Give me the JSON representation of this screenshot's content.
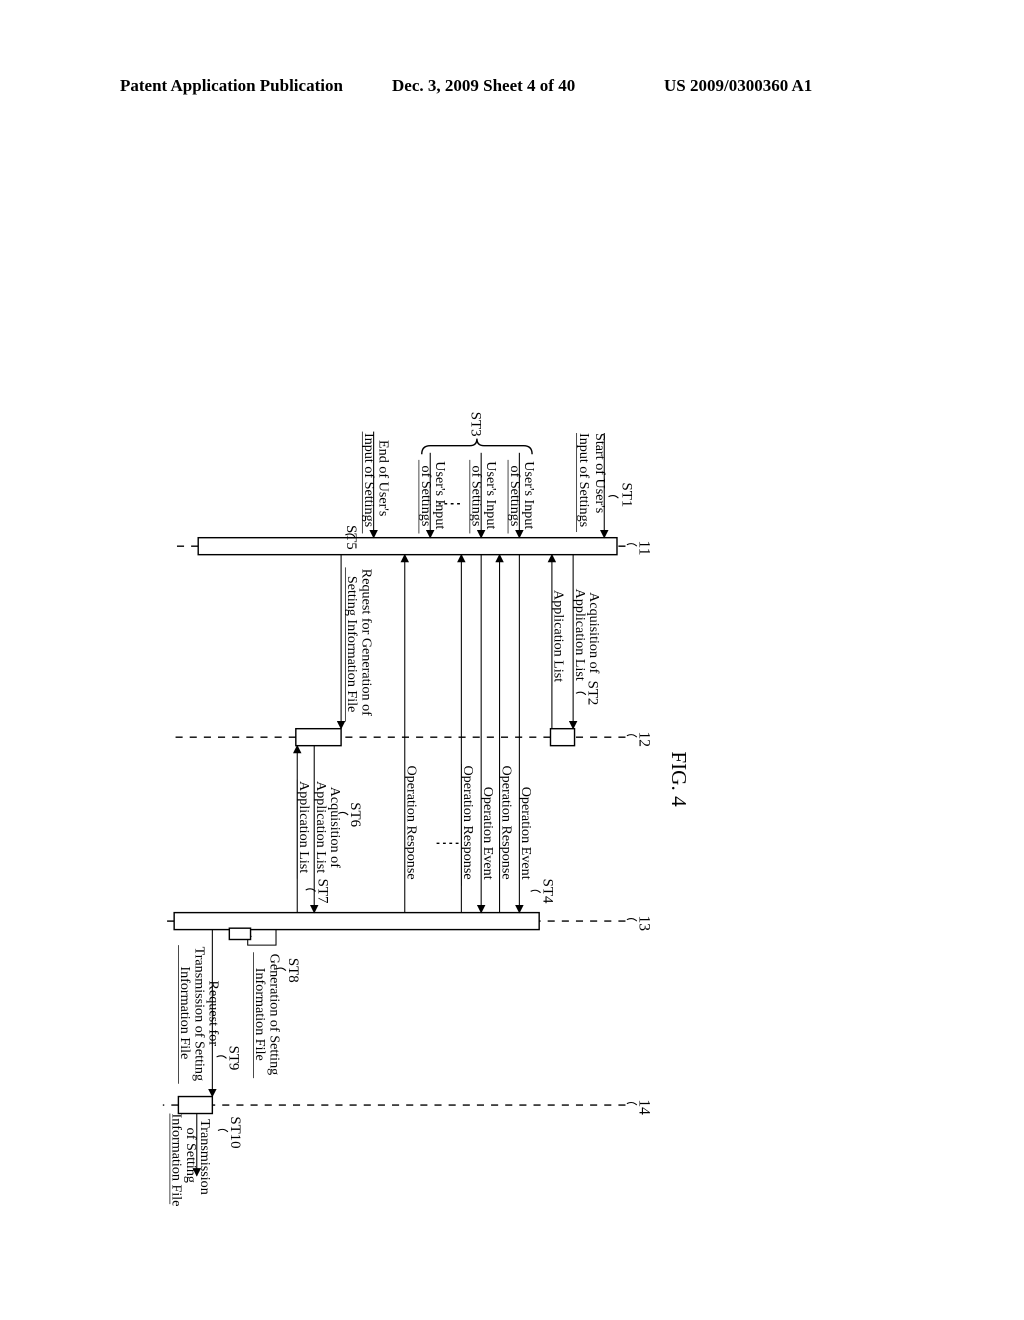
{
  "header": {
    "left": "Patent Application Publication",
    "mid": "Dec. 3, 2009  Sheet 4 of 40",
    "right": "US 2009/0300360 A1"
  },
  "figure": {
    "title": "FIG. 4",
    "lanes": {
      "l1": "11",
      "l2": "12",
      "l3": "13",
      "l4": "14"
    },
    "steps": {
      "st1": "ST1",
      "st2": "ST2",
      "st3": "ST3",
      "st4": "ST4",
      "st5": "ST5",
      "st6": "ST6",
      "st7": "ST7",
      "st8": "ST8",
      "st9": "ST9",
      "st10": "ST10"
    },
    "labels": {
      "start_input": "Start of User's\nInput of Settings",
      "acq_app_list_12": "Acquisition of\nApplication List",
      "app_list_12": "Application List",
      "user_input": "User's Input\nof Settings",
      "op_event": "Operation Event",
      "op_response": "Operation Response",
      "end_input": "End of User's\nInput of Settings",
      "req_gen": "Request for Generation of\nSetting Information File",
      "acq_app_list_13": "Acquisition of\nApplication List",
      "app_list_13": "Application List",
      "gen_setting": "Generation of Setting\nInformation File",
      "req_trans": "Request for\nTransmission of Setting\nInformation File",
      "trans_setting": "Transmission\nof Setting\nInformation File"
    }
  }
}
